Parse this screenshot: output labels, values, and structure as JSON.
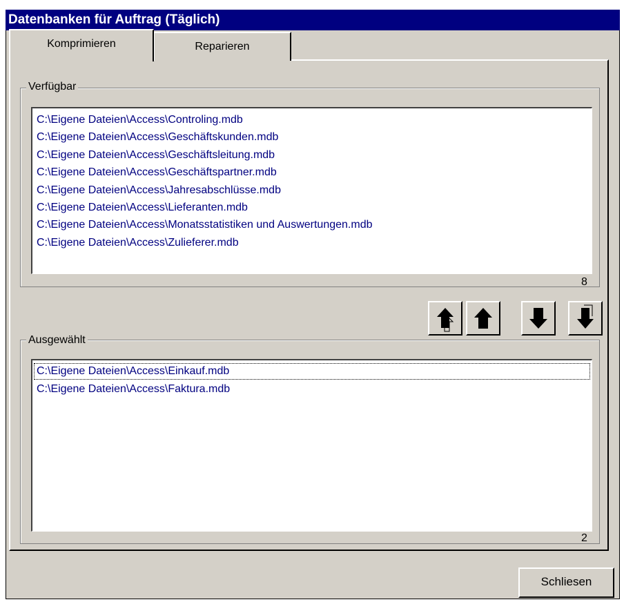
{
  "window": {
    "title": "Datenbanken für Auftrag (Täglich)"
  },
  "tabs": [
    {
      "label": "Komprimieren",
      "active": true
    },
    {
      "label": "Reparieren",
      "active": false
    }
  ],
  "available": {
    "label": "Verfügbar",
    "items": [
      "C:\\Eigene Dateien\\Access\\Controling.mdb",
      "C:\\Eigene Dateien\\Access\\Geschäftskunden.mdb",
      "C:\\Eigene Dateien\\Access\\Geschäftsleitung.mdb",
      "C:\\Eigene Dateien\\Access\\Geschäftspartner.mdb",
      "C:\\Eigene Dateien\\Access\\Jahresabschlüsse.mdb",
      "C:\\Eigene Dateien\\Access\\Lieferanten.mdb",
      "C:\\Eigene Dateien\\Access\\Monatsstatistiken und Auswertungen.mdb",
      "C:\\Eigene Dateien\\Access\\Zulieferer.mdb"
    ],
    "count": "8"
  },
  "move_buttons": [
    {
      "name": "move-all-up-icon"
    },
    {
      "name": "move-up-icon"
    },
    {
      "name": "move-down-icon"
    },
    {
      "name": "move-all-down-icon"
    }
  ],
  "selected": {
    "label": "Ausgewählt",
    "items": [
      "C:\\Eigene Dateien\\Access\\Einkauf.mdb",
      "C:\\Eigene Dateien\\Access\\Faktura.mdb"
    ],
    "count": "2"
  },
  "footer": {
    "close_label": "Schliesen"
  },
  "colors": {
    "titlebar": "#000080",
    "list_text": "#000080",
    "face": "#d4d0c8"
  }
}
